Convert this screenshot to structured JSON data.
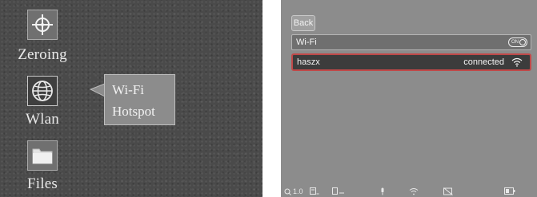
{
  "left_menu": {
    "items": [
      {
        "label": "Zeroing",
        "icon": "crosshair-icon"
      },
      {
        "label": "Wlan",
        "icon": "globe-icon"
      },
      {
        "label": "Files",
        "icon": "folder-icon"
      }
    ],
    "tooltip": {
      "line1": "Wi-Fi",
      "line2": "Hotspot"
    }
  },
  "wifi_screen": {
    "back_label": "Back",
    "wifi_label": "Wi-Fi",
    "wifi_toggle": {
      "text": "ON",
      "state": "on"
    },
    "network": {
      "ssid": "haszx",
      "status": "connected",
      "icon": "wifi-signal-icon"
    },
    "highlight_color": "#c04848"
  },
  "status_bar": {
    "zoom": "1.0",
    "icons": [
      "zoom-icon",
      "image-mode-icon",
      "palette-icon",
      "mic-icon",
      "wifi-icon",
      "no-record-icon",
      "battery-icon"
    ]
  }
}
